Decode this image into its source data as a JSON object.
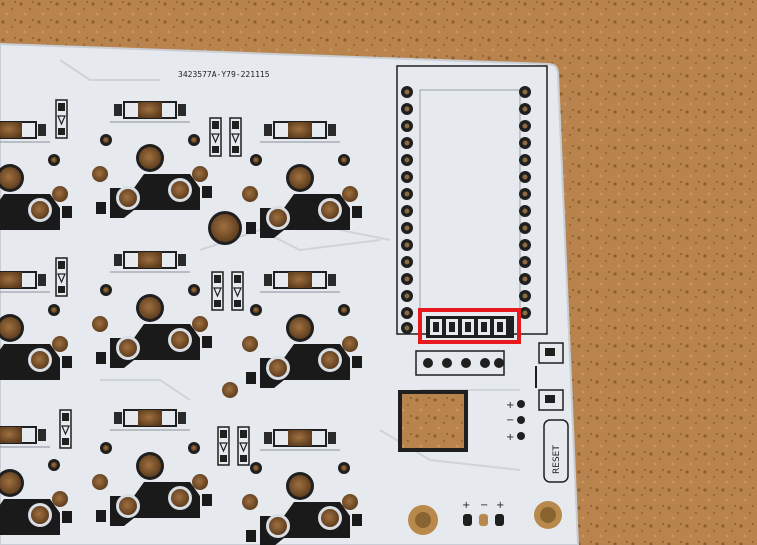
{
  "photo": {
    "subject": "keyboard-pcb",
    "colors": {
      "cork": "#b9834e",
      "cork_dark": "#8e5e31",
      "pcb": "#e6e9ee",
      "pcb_shadow": "#c9cdd4",
      "silk_black": "#1f1f1f",
      "highlight": "#e8191c",
      "copper": "#b8894a"
    }
  },
  "pcb": {
    "serial_text": "3423577A-Y79-221115",
    "reset_label": "RESET",
    "polarity_marks": {
      "right_column": [
        "+",
        "−",
        "+"
      ],
      "bottom_row": [
        "+",
        "−",
        "+"
      ]
    }
  },
  "highlight_box": {
    "label": "highlighted-5-pin-header",
    "pads": 5
  }
}
